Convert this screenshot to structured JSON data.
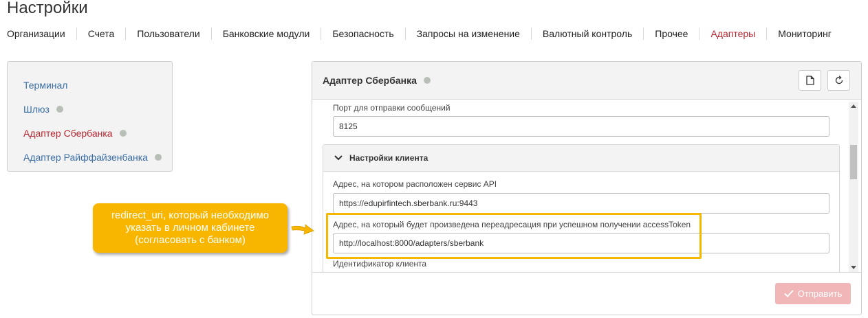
{
  "page": {
    "title": "Настройки"
  },
  "tabs": [
    {
      "label": "Организации"
    },
    {
      "label": "Счета"
    },
    {
      "label": "Пользователи"
    },
    {
      "label": "Банковские модули"
    },
    {
      "label": "Безопасность"
    },
    {
      "label": "Запросы на изменение"
    },
    {
      "label": "Валютный контроль"
    },
    {
      "label": "Прочее"
    },
    {
      "label": "Адаптеры",
      "active": true
    },
    {
      "label": "Мониторинг"
    }
  ],
  "sidebar": {
    "items": [
      {
        "label": "Терминал"
      },
      {
        "label": "Шлюз",
        "status_dot": true
      },
      {
        "label": "Адаптер Сбербанка",
        "status_dot": true,
        "active": true
      },
      {
        "label": "Адаптер Райффайзенбанка",
        "status_dot": true
      }
    ]
  },
  "panel": {
    "title": "Адаптер Сбербанка",
    "status_color": "#b7bfb7",
    "icons": [
      "file-icon",
      "refresh-icon"
    ],
    "fields": {
      "port_label": "Порт для отправки сообщений",
      "port_value": "8125",
      "client_section_title": "Настройки клиента",
      "api_address_label": "Адрес, на котором расположен сервис API",
      "api_address_value": "https://edupirfintech.sberbank.ru:9443",
      "redirect_label": "Адрес, на который будет произведена переадресация при успешном получении accessToken",
      "redirect_value": "http://localhost:8000/adapters/sberbank",
      "client_id_label": "Идентификатор клиента"
    },
    "submit_label": "Отправить"
  },
  "annotation": {
    "text": "redirect_uri, который необходимо указать в личном кабинете (согласовать с банком)",
    "color": "#f8b600"
  },
  "colors": {
    "accent": "#b5262f",
    "link": "#3a6ea5",
    "submit_disabled": "#f1b6b8"
  }
}
